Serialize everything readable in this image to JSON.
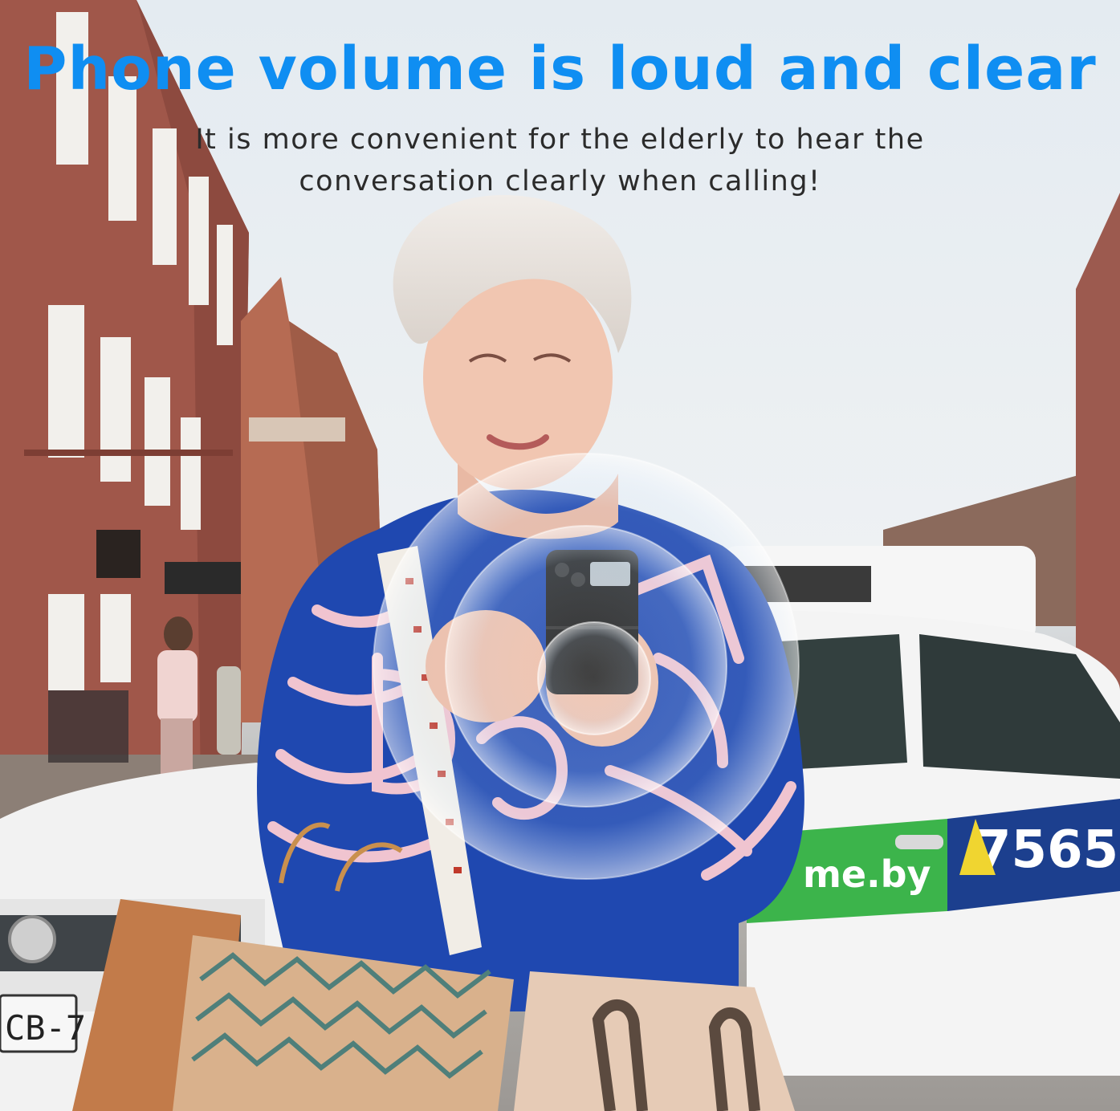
{
  "headline": "Phone volume is loud and clear",
  "subline": "It is more convenient for the elderly to hear the conversation clearly when calling!",
  "taxi": {
    "door_text": "me.by",
    "number_text": "7565"
  },
  "plate_text": "CB-7",
  "colors": {
    "headline": "#0f8ef2",
    "sweater": "#1f48b0",
    "taxi": "#f4f4f4",
    "taxi_stripe": "#34b24b"
  }
}
